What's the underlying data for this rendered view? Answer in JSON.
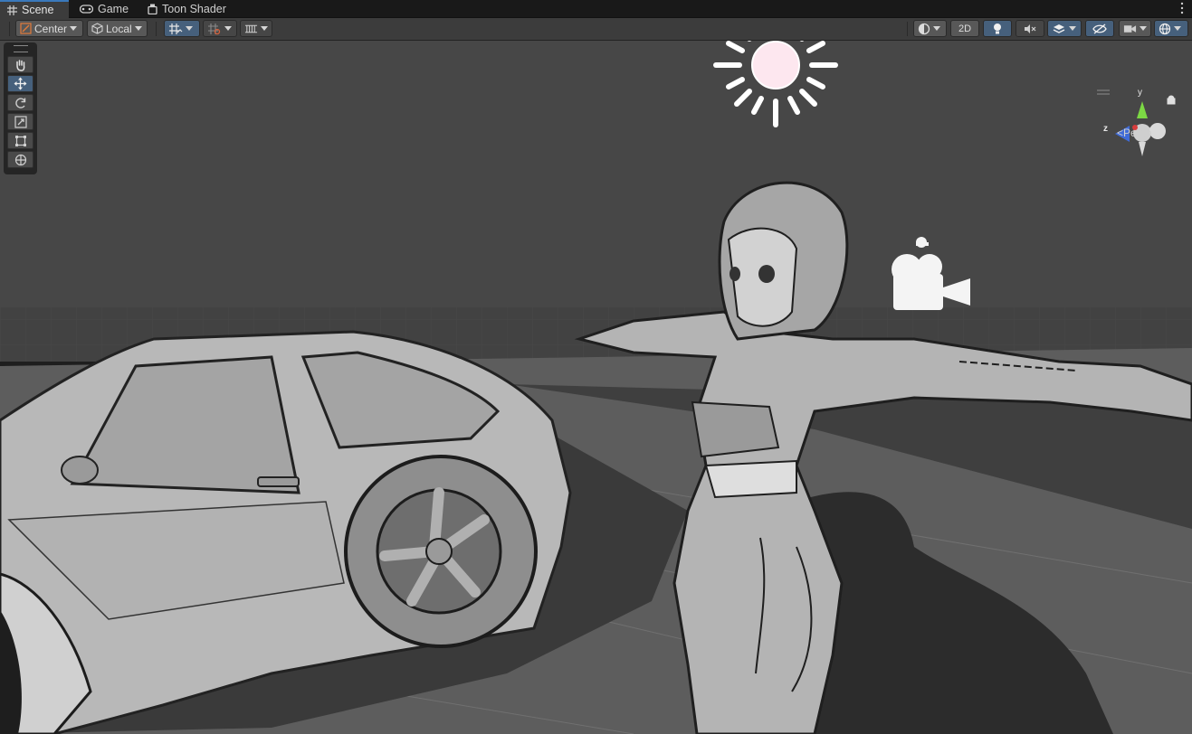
{
  "tabs": [
    {
      "label": "Scene",
      "icon": "grid-icon",
      "active": true
    },
    {
      "label": "Game",
      "icon": "gamepad-icon",
      "active": false
    },
    {
      "label": "Toon Shader",
      "icon": "toon-shader-icon",
      "active": false
    }
  ],
  "toolbar": {
    "pivot_label": "Center",
    "space_label": "Local",
    "twod_label": "2D"
  },
  "gizmo": {
    "axis_y": "y",
    "axis_z": "z",
    "projection_label": "Persp"
  },
  "tools": [
    "hand-tool",
    "move-tool",
    "rotate-tool",
    "scale-tool",
    "rect-tool",
    "transform-tool"
  ],
  "active_tool": "move-tool",
  "colors": {
    "accent": "#46607c",
    "tab_highlight": "#3a79bb",
    "gizmo_y": "#7cd844",
    "gizmo_z": "#3f6bd8",
    "gizmo_x": "#d83c3c"
  }
}
